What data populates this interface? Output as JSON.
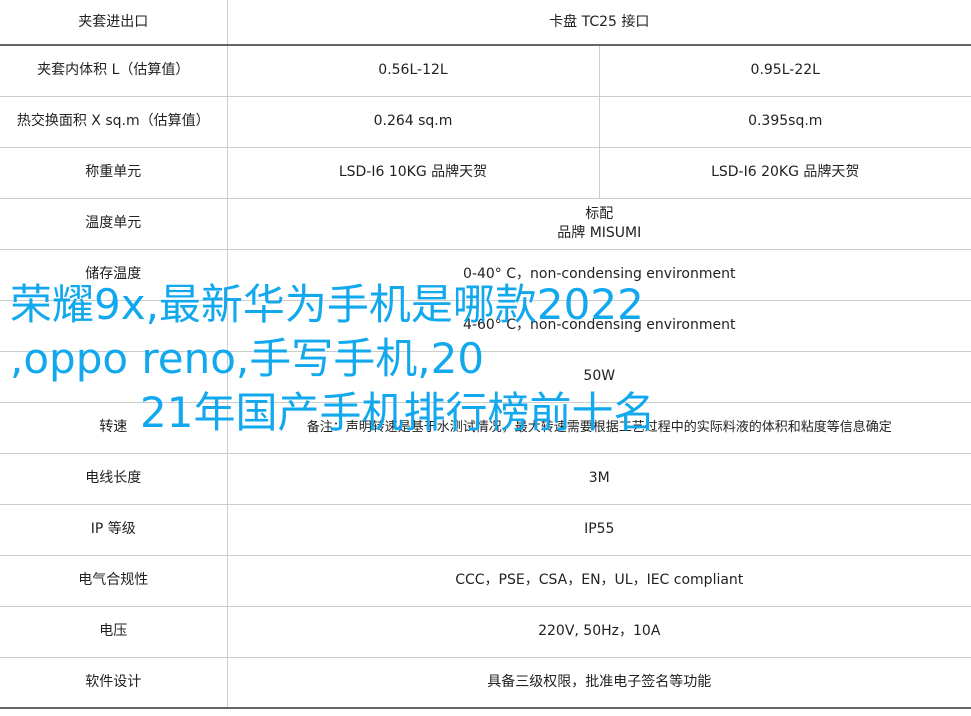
{
  "rows": [
    {
      "label": "夹套进出口",
      "left": "卡盘 TC25 接口"
    },
    {
      "label": "夹套内体积 L（估算值）",
      "left": "0.56L-12L",
      "right": "0.95L-22L"
    },
    {
      "label": "热交换面积 X sq.m（估算值）",
      "left": "0.264 sq.m",
      "right": "0.395sq.m"
    },
    {
      "label": "称重单元",
      "left": "LSD-I6 10KG 品牌天贺",
      "right": "LSD-I6 20KG 品牌天贺"
    },
    {
      "label": "温度单元",
      "line1": "标配",
      "line2": "品牌 MISUMI"
    },
    {
      "label": "储存温度",
      "left": "0-40° C，non-condensing environment"
    },
    {
      "label": "",
      "left": "4-60° C，non-condensing environment"
    },
    {
      "label": "",
      "left": "50W"
    },
    {
      "label": "转速",
      "left": "备注：声明转速是基于水测试情况，最大转速需要根据工艺过程中的实际料液的体积和粘度等信息确定"
    },
    {
      "label": "电线长度",
      "left": "3M"
    },
    {
      "label": "IP 等级",
      "left": "IP55"
    },
    {
      "label": "电气合规性",
      "left": "CCC，PSE，CSA，EN，UL，IEC compliant"
    },
    {
      "label": "电压",
      "left": "220V, 50Hz，10A"
    },
    {
      "label": "软件设计",
      "left": "具备三级权限，批准电子签名等功能"
    }
  ],
  "overlay": {
    "line1": "荣耀9x,最新华为手机是哪款2022",
    "line2": ",oppo reno,手写手机,20",
    "line3": "21年国产手机排行榜前十名"
  }
}
